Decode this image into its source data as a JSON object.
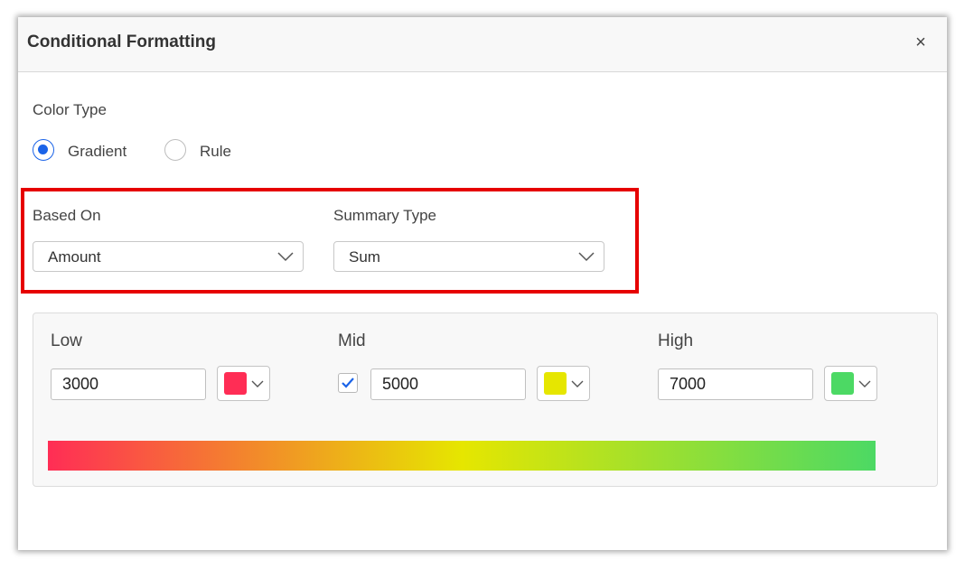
{
  "dialog": {
    "title": "Conditional Formatting",
    "close_glyph": "×"
  },
  "color_type": {
    "label": "Color Type",
    "options": [
      {
        "label": "Gradient",
        "checked": true
      },
      {
        "label": "Rule",
        "checked": false
      }
    ]
  },
  "based_on": {
    "label": "Based On",
    "value": "Amount"
  },
  "summary_type": {
    "label": "Summary Type",
    "value": "Sum"
  },
  "gradient": {
    "low": {
      "label": "Low",
      "value": "3000",
      "color": "#ff2d55"
    },
    "mid": {
      "label": "Mid",
      "value": "5000",
      "color": "#e6e600",
      "enabled": true
    },
    "high": {
      "label": "High",
      "value": "7000",
      "color": "#4cd964"
    }
  },
  "colors": {
    "accent": "#1a63e8",
    "highlight_border": "#e60000"
  },
  "icons": {
    "close": "close-icon",
    "dropdown": "chevron-down-icon",
    "check": "check-icon"
  }
}
